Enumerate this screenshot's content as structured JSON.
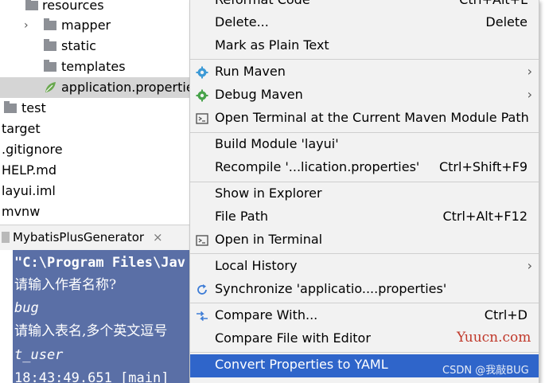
{
  "tree": {
    "resources": "resources",
    "mapper": "mapper",
    "static": "static",
    "templates": "templates",
    "application_properties": "application.properties",
    "test": "test",
    "target": "target",
    "gitignore": ".gitignore",
    "help": "HELP.md",
    "iml": "layui.iml",
    "mvnw": "mvnw"
  },
  "run_panel": {
    "tab_label": "MybatisPlusGenerator",
    "close_glyph": "×",
    "console_lines": [
      "\"C:\\Program Files\\Jav",
      "请输入作者名称?",
      "bug",
      "请输入表名,多个英文逗号",
      "t_user",
      "18:43:49.651 [main] "
    ]
  },
  "menu": {
    "reformat": {
      "label": "Reformat Code",
      "shortcut": "Ctrl+Alt+L"
    },
    "delete": {
      "label": "Delete...",
      "shortcut": "Delete"
    },
    "mark_plain": {
      "label": "Mark as Plain Text"
    },
    "run_maven": {
      "label": "Run Maven"
    },
    "debug_maven": {
      "label": "Debug Maven"
    },
    "open_terminal_module": {
      "label": "Open Terminal at the Current Maven Module Path"
    },
    "build_module": {
      "label": "Build Module 'layui'"
    },
    "recompile": {
      "label": "Recompile '...lication.properties'",
      "shortcut": "Ctrl+Shift+F9"
    },
    "show_explorer": {
      "label": "Show in Explorer"
    },
    "file_path": {
      "label": "File Path",
      "shortcut": "Ctrl+Alt+F12"
    },
    "open_terminal": {
      "label": "Open in Terminal"
    },
    "local_history": {
      "label": "Local History"
    },
    "synchronize": {
      "label": "Synchronize 'applicatio....properties'"
    },
    "compare_with": {
      "label": "Compare With...",
      "shortcut": "Ctrl+D"
    },
    "compare_editor": {
      "label": "Compare File with Editor"
    },
    "convert_yaml": {
      "label": "Convert Properties to YAML"
    }
  },
  "watermarks": {
    "site": "Yuucn.com",
    "csdn": "CSDN @我敲BUG"
  },
  "colors": {
    "highlight": "#2f65ca",
    "console_bg": "#5a6fa6",
    "menu_bg": "#f2f2f2",
    "watermark_red": "#c0392b"
  },
  "icons": {
    "folder": "folder-icon",
    "properties": "leaf-icon",
    "run_maven": "gear-icon",
    "debug_maven": "gear-icon",
    "terminal": "terminal-icon",
    "compare": "compare-arrows-icon",
    "submenu": "chevron-right-icon"
  }
}
